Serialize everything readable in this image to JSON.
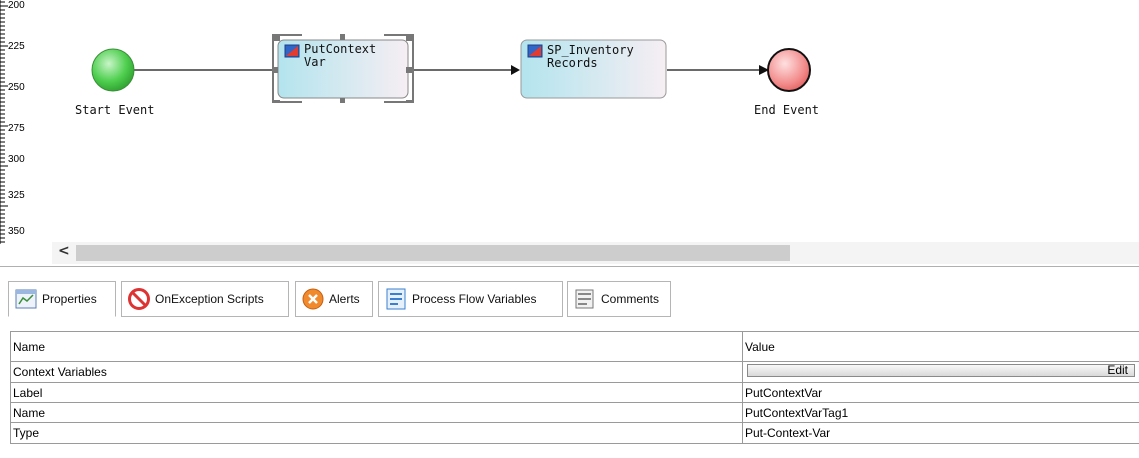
{
  "ruler": {
    "ticks": [
      "200",
      "225",
      "250",
      "275",
      "300",
      "325",
      "350"
    ]
  },
  "flow": {
    "start_label": "Start Event",
    "task1": {
      "line1": "PutContext",
      "line2": "Var"
    },
    "task2": {
      "line1": "SP_Inventory",
      "line2": "Records"
    },
    "end_label": "End Event"
  },
  "scroll": {
    "left_arrow": "<"
  },
  "tabs": [
    {
      "label": "Properties",
      "icon": "properties-icon"
    },
    {
      "label": "OnException Scripts",
      "icon": "no-entry-icon"
    },
    {
      "label": "Alerts",
      "icon": "alert-x-icon"
    },
    {
      "label": "Process Flow Variables",
      "icon": "variables-icon"
    },
    {
      "label": "Comments",
      "icon": "comments-icon"
    }
  ],
  "properties": {
    "header": {
      "name": "Name",
      "value": "Value"
    },
    "rows": [
      {
        "name": "Context Variables",
        "value": "",
        "button": "Edit"
      },
      {
        "name": "Label",
        "value": "PutContextVar"
      },
      {
        "name": "Name",
        "value": "PutContextVarTag1"
      },
      {
        "name": "Type",
        "value": "Put-Context-Var"
      }
    ]
  },
  "colors": {
    "start": "#3fbf3f",
    "end": "#f08080",
    "task_bg": "#bfe6ee",
    "accent": "#3a7fd0"
  }
}
